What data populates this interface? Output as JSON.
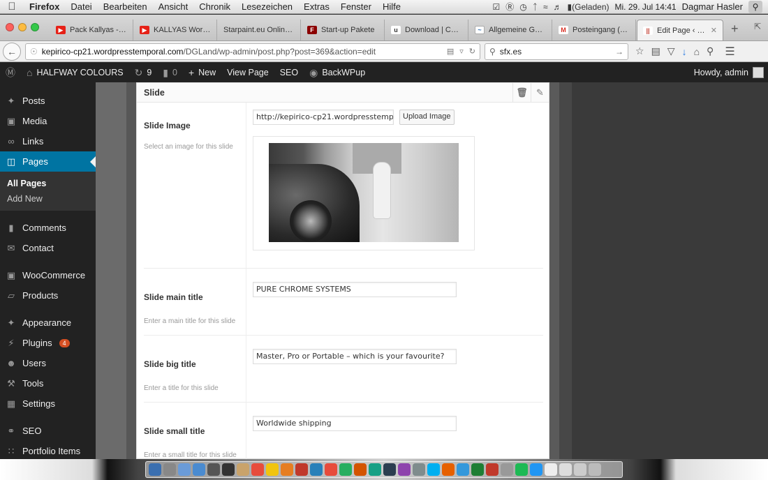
{
  "menubar": {
    "app": "Firefox",
    "items": [
      "Datei",
      "Bearbeiten",
      "Ansicht",
      "Chronik",
      "Lesezeichen",
      "Extras",
      "Fenster",
      "Hilfe"
    ],
    "battery": "(Geladen)",
    "clock": "Mi. 29. Jul  14:41",
    "user": "Dagmar Hasler"
  },
  "tabs": [
    {
      "label": "Pack Kallyas - El...",
      "color": "#e62117",
      "glyph": "▶"
    },
    {
      "label": "KALLYAS WordPr...",
      "color": "#e62117",
      "glyph": "▶"
    },
    {
      "label": "Starpaint.eu Onlines...",
      "color": "#cccccc",
      "glyph": ""
    },
    {
      "label": "Start-up Pakete",
      "color": "#8b0000",
      "glyph": "F"
    },
    {
      "label": "Download | Car...",
      "color": "#555555",
      "glyph": "u"
    },
    {
      "label": "Allgemeine Gesc...",
      "color": "#2b6cb0",
      "glyph": "~"
    },
    {
      "label": "Posteingang (9) ...",
      "color": "#d93025",
      "glyph": "M"
    },
    {
      "label": "Edit Page ‹ H...",
      "color": "#c0392b",
      "glyph": "||"
    }
  ],
  "navbar": {
    "url_host": "kepirico-cp21.wordpresstemporal.com",
    "url_path": "/DGLand/wp-admin/post.php?post=369&action=edit",
    "search": "sfx.es"
  },
  "adminbar": {
    "site": "HALFWAY COLOURS",
    "updates": "9",
    "comments": "0",
    "new": "New",
    "view": "View Page",
    "seo": "SEO",
    "backwpup": "BackWPup",
    "howdy": "Howdy, admin"
  },
  "sidebar": {
    "posts": "Posts",
    "media": "Media",
    "links": "Links",
    "pages": "Pages",
    "all_pages": "All Pages",
    "add_new": "Add New",
    "comments": "Comments",
    "contact": "Contact",
    "woocommerce": "WooCommerce",
    "products": "Products",
    "appearance": "Appearance",
    "plugins": "Plugins",
    "plugins_badge": "4",
    "users": "Users",
    "tools": "Tools",
    "settings": "Settings",
    "seo": "SEO",
    "portfolio": "Portfolio Items"
  },
  "panel": {
    "title": "Slide",
    "image": {
      "label": "Slide Image",
      "desc": "Select an image for this slide",
      "value": "http://kepirico-cp21.wordpresstempo",
      "upload": "Upload Image"
    },
    "main_title": {
      "label": "Slide main title",
      "desc": "Enter a main title for this slide",
      "value": "PURE CHROME SYSTEMS"
    },
    "big_title": {
      "label": "Slide big title",
      "desc": "Enter a title for this slide",
      "value": "Master, Pro or Portable – which is your favourite?"
    },
    "small_title": {
      "label": "Slide small title",
      "desc": "Enter a small title for this slide",
      "value": "Worldwide shipping"
    }
  }
}
